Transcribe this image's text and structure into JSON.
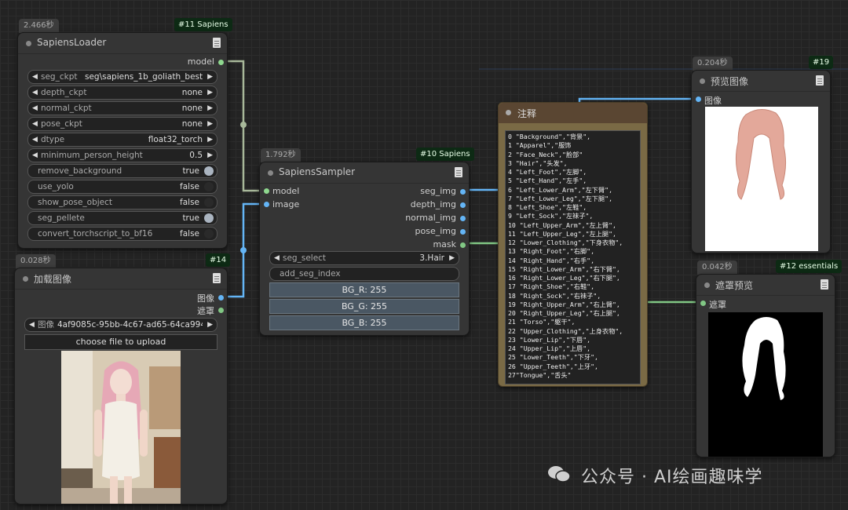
{
  "loader": {
    "timing": "2.466秒",
    "badge": "#11 Sapiens",
    "title": "SapiensLoader",
    "output": "model",
    "widgets": [
      {
        "label": "seg_ckpt",
        "value": "seg\\sapiens_1b_goliath_best..."
      },
      {
        "label": "depth_ckpt",
        "value": "none"
      },
      {
        "label": "normal_ckpt",
        "value": "none"
      },
      {
        "label": "pose_ckpt",
        "value": "none"
      },
      {
        "label": "dtype",
        "value": "float32_torch"
      },
      {
        "label": "minimum_person_height",
        "value": "0.5"
      }
    ],
    "toggles": [
      {
        "label": "remove_background",
        "value": "true",
        "on": true
      },
      {
        "label": "use_yolo",
        "value": "false",
        "on": false
      },
      {
        "label": "show_pose_object",
        "value": "false",
        "on": false
      },
      {
        "label": "seg_pellete",
        "value": "true",
        "on": true
      },
      {
        "label": "convert_torchscript_to_bf16",
        "value": "false",
        "on": false
      }
    ]
  },
  "load_image": {
    "timing": "0.028秒",
    "badge": "#14",
    "title": "加载图像",
    "outputs": [
      "图像",
      "遮罩"
    ],
    "widget_label": "图像",
    "widget_value": "4af9085c-95bb-4c67-ad65-64ca994...",
    "upload_label": "choose file to upload"
  },
  "sampler": {
    "timing": "1.792秒",
    "badge": "#10 Sapiens",
    "title": "SapiensSampler",
    "inputs": [
      "model",
      "image"
    ],
    "outputs": [
      "seg_img",
      "depth_img",
      "normal_img",
      "pose_img",
      "mask"
    ],
    "seg_select_label": "seg_select",
    "seg_select_value": "3.Hair",
    "add_seg_index": "add_seg_index",
    "bg_buttons": [
      "BG_R: 255",
      "BG_G: 255",
      "BG_B: 255"
    ]
  },
  "note": {
    "title": "注释",
    "text": "0 \"Background\",\"背景\",\n1 \"Apparel\",\"服饰\n2 \"Face_Neck\",\"脸部\"\n3 \"Hair\",\"头发\",\n4 \"Left_Foot\",\"左脚\",\n5 \"Left_Hand\",\"左手\",\n6 \"Left_Lower_Arm\",\"左下臂\",\n7 \"Left_Lower_Leg\",\"左下腿\",\n8 \"Left_Shoe\",\"左鞋\",\n9 \"Left_Sock\",\"左袜子\",\n10 \"Left_Upper_Arm\",\"左上臂\",\n11 \"Left_Upper_Leg\",\"左上腿\",\n12 \"Lower_Clothing\",\"下身衣物\",\n13 \"Right_Foot\",\"右脚\",\n14 \"Right_Hand\",\"右手\",\n15 \"Right_Lower_Arm\",\"右下臂\",\n16 \"Right_Lower_Leg\",\"右下腿\",\n17 \"Right_Shoe\",\"右鞋\",\n18 \"Right_Sock\",\"右袜子\",\n19 \"Right_Upper_Arm\",\"右上臂\",\n20 \"Right_Upper_Leg\",\"右上腿\",\n21 \"Torso\",\"躯干\",\n22 \"Upper_Clothing\",\"上身衣物\",\n23 \"Lower_Lip\",\"下唇\",\n24 \"Upper_Lip\",\"上唇\",\n25 \"Lower_Teeth\",\"下牙\",\n26 \"Upper_Teeth\",\"上牙\",\n27\"Tongue\",\"舌头\""
  },
  "preview": {
    "timing": "0.204秒",
    "badge": "#19",
    "title": "预览图像",
    "input": "图像"
  },
  "mask_preview": {
    "timing": "0.042秒",
    "badge": "#12 essentials",
    "title": "遮罩预览",
    "input": "遮罩"
  },
  "watermark": "公众号 · AI绘画趣味学",
  "colors": {
    "model_port": "#8fd88f",
    "image_port": "#64b5f6",
    "mask_port": "#81c784",
    "note_title_bg": "#5a4632",
    "note_border": "#7a6a45"
  }
}
